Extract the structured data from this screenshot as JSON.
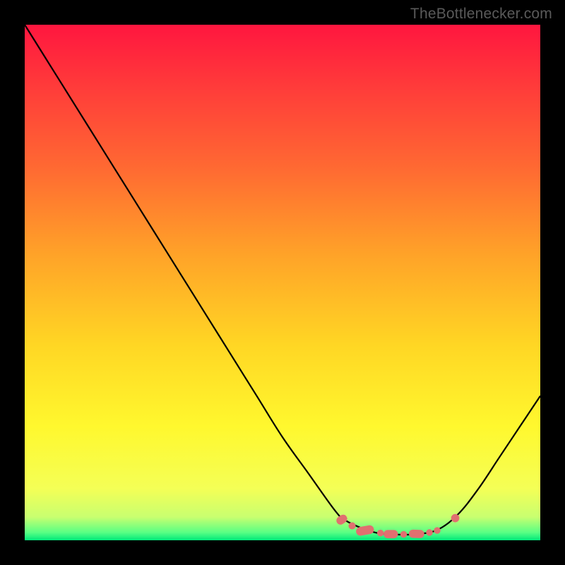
{
  "watermark": "TheBottlenecker.com",
  "chart_data": {
    "type": "line",
    "title": "",
    "xlabel": "",
    "ylabel": "",
    "xlim": [
      0,
      100
    ],
    "ylim": [
      0,
      100
    ],
    "series": [
      {
        "name": "bottleneck-curve",
        "x": [
          0,
          5,
          10,
          15,
          20,
          25,
          30,
          35,
          40,
          45,
          50,
          55,
          60,
          62,
          65,
          68,
          70,
          73,
          76,
          80,
          84,
          88,
          92,
          96,
          100
        ],
        "y": [
          100,
          92,
          84,
          76,
          68,
          60,
          52,
          44,
          36,
          28,
          20,
          13,
          6,
          4,
          2.5,
          1.5,
          1.2,
          1.1,
          1.2,
          2,
          5,
          10,
          16,
          22,
          28
        ],
        "color": "#000000"
      }
    ],
    "markers": {
      "name": "optimal-range",
      "color": "#e07070",
      "points": [
        {
          "x": 61.5,
          "y": 4.0,
          "w": 2.2,
          "h": 1.6,
          "rot": -35
        },
        {
          "x": 63.5,
          "y": 2.8,
          "w": 1.4,
          "h": 1.4,
          "rot": 0
        },
        {
          "x": 66.0,
          "y": 1.9,
          "w": 3.5,
          "h": 1.7,
          "rot": -10
        },
        {
          "x": 69.0,
          "y": 1.4,
          "w": 1.3,
          "h": 1.3,
          "rot": 0
        },
        {
          "x": 71.0,
          "y": 1.2,
          "w": 2.8,
          "h": 1.6,
          "rot": 0
        },
        {
          "x": 73.5,
          "y": 1.15,
          "w": 1.3,
          "h": 1.3,
          "rot": 0
        },
        {
          "x": 76.0,
          "y": 1.25,
          "w": 3.0,
          "h": 1.6,
          "rot": 2
        },
        {
          "x": 78.5,
          "y": 1.5,
          "w": 1.3,
          "h": 1.3,
          "rot": 0
        },
        {
          "x": 80.0,
          "y": 1.9,
          "w": 1.3,
          "h": 1.3,
          "rot": 0
        },
        {
          "x": 83.5,
          "y": 4.3,
          "w": 1.6,
          "h": 1.6,
          "rot": 0
        }
      ]
    },
    "gradient": {
      "stops": [
        {
          "offset": 0,
          "color": "#ff163f"
        },
        {
          "offset": 0.12,
          "color": "#ff3b3a"
        },
        {
          "offset": 0.28,
          "color": "#ff6a32"
        },
        {
          "offset": 0.45,
          "color": "#ffa428"
        },
        {
          "offset": 0.62,
          "color": "#ffd624"
        },
        {
          "offset": 0.78,
          "color": "#fff82e"
        },
        {
          "offset": 0.9,
          "color": "#f4ff56"
        },
        {
          "offset": 0.955,
          "color": "#c8ff70"
        },
        {
          "offset": 0.985,
          "color": "#58ff84"
        },
        {
          "offset": 1.0,
          "color": "#00e87a"
        }
      ]
    }
  }
}
